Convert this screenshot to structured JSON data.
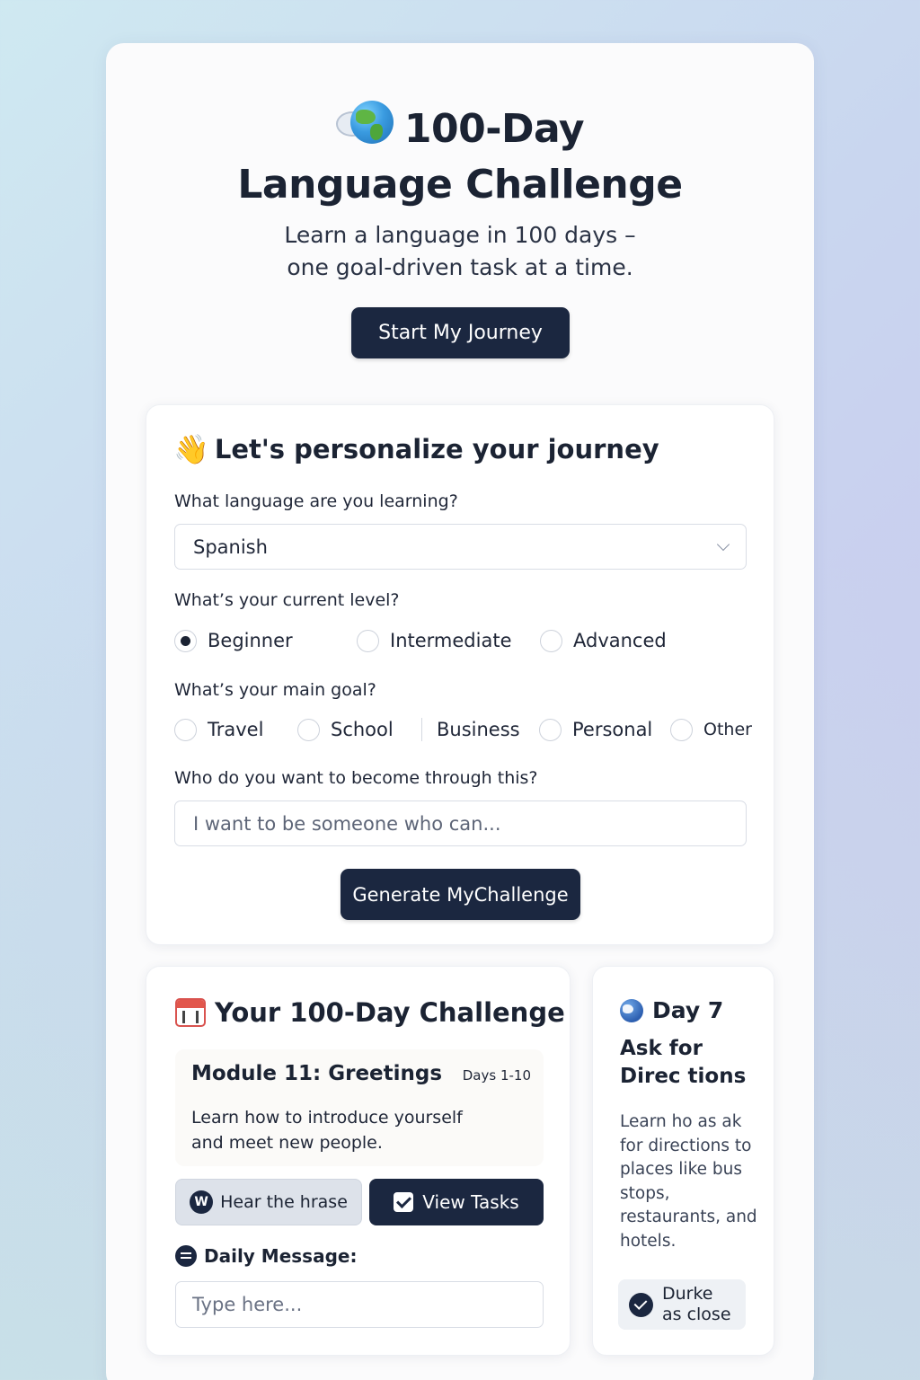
{
  "hero": {
    "title_line1": "100-Day",
    "title_line2": "Language Challenge",
    "subtitle_line1": "Learn a language in 100 days –",
    "subtitle_line2": "one goal-driven task at a time.",
    "start_button": "Start My Journey",
    "globe_icon": "globe-speech-icon"
  },
  "personalize": {
    "heading": "Let's personalize your journey",
    "heading_icon": "waving-hand-icon",
    "language_label": "What language are you learning?",
    "language_value": "Spanish",
    "level_label": "What’s your current level?",
    "levels": [
      "Beginner",
      "Intermediate",
      "Advanced"
    ],
    "level_selected": "Beginner",
    "goal_label": "What’s your main goal?",
    "goals": [
      "Travel",
      "School",
      "Business",
      "Personal",
      "Other"
    ],
    "identity_label": "Who do you want to become through this?",
    "identity_placeholder": "I want to be someone who can...",
    "generate_button": "Generate MyChallenge"
  },
  "challenge": {
    "heading": "Your 100-Day Challenge",
    "heading_icon": "calendar-icon",
    "module_title": "Module 11: Greetings",
    "module_days": "Days 1-10",
    "module_desc": "Learn how to introduce yourself and meet new people.",
    "hear_button": "Hear the hrase",
    "view_tasks_button": "View Tasks",
    "daily_label": "Daily Message:",
    "daily_placeholder": "Type here..."
  },
  "day": {
    "heading": "Day 7",
    "title": "Ask for Direc tions",
    "desc": "Learn ho as ak for directions to places like bus stops, restaurants, and hotels.",
    "done_line1": "Durke",
    "done_line2": "as close"
  },
  "colors": {
    "accent": "#1b2740",
    "card": "#fbfbfc"
  }
}
